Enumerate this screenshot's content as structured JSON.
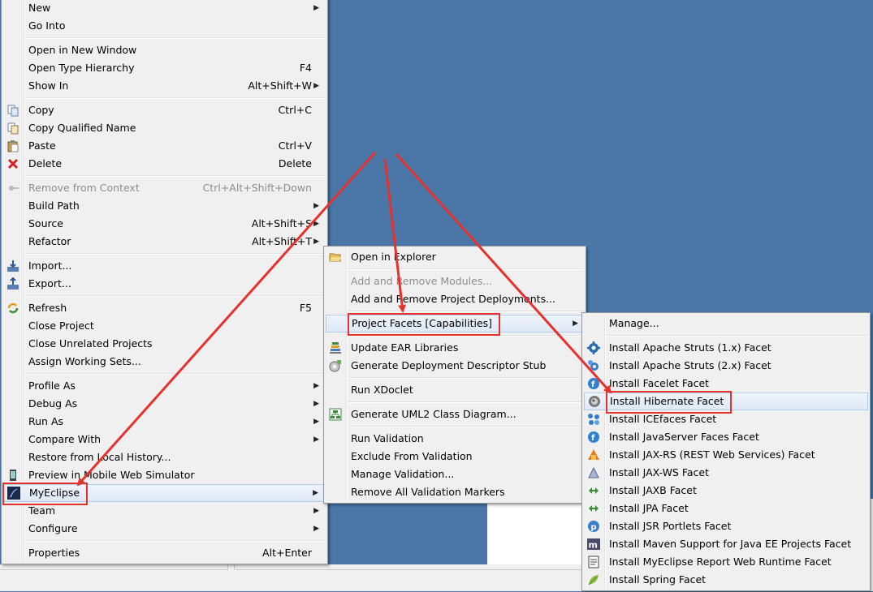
{
  "main_menu": {
    "items": [
      {
        "label": "New",
        "arrow": true
      },
      {
        "label": "Go Into"
      },
      {
        "sep": true
      },
      {
        "label": "Open in New Window"
      },
      {
        "label": "Open Type Hierarchy",
        "shortcut": "F4"
      },
      {
        "label": "Show In",
        "shortcut": "Alt+Shift+W",
        "arrow": true
      },
      {
        "sep": true
      },
      {
        "label": "Copy",
        "shortcut": "Ctrl+C",
        "icon": "copy-icon"
      },
      {
        "label": "Copy Qualified Name",
        "icon": "copy-qualified-icon"
      },
      {
        "label": "Paste",
        "shortcut": "Ctrl+V",
        "icon": "paste-icon"
      },
      {
        "label": "Delete",
        "shortcut": "Delete",
        "icon": "delete-icon"
      },
      {
        "sep": true
      },
      {
        "label": "Remove from Context",
        "shortcut": "Ctrl+Alt+Shift+Down",
        "icon": "remove-context-icon",
        "disabled": true
      },
      {
        "label": "Build Path",
        "arrow": true
      },
      {
        "label": "Source",
        "shortcut": "Alt+Shift+S",
        "arrow": true
      },
      {
        "label": "Refactor",
        "shortcut": "Alt+Shift+T",
        "arrow": true
      },
      {
        "sep": true
      },
      {
        "label": "Import...",
        "icon": "import-icon"
      },
      {
        "label": "Export...",
        "icon": "export-icon"
      },
      {
        "sep": true
      },
      {
        "label": "Refresh",
        "shortcut": "F5",
        "icon": "refresh-icon"
      },
      {
        "label": "Close Project"
      },
      {
        "label": "Close Unrelated Projects"
      },
      {
        "label": "Assign Working Sets..."
      },
      {
        "sep": true
      },
      {
        "label": "Profile As",
        "arrow": true
      },
      {
        "label": "Debug As",
        "arrow": true
      },
      {
        "label": "Run As",
        "arrow": true
      },
      {
        "label": "Compare With",
        "arrow": true
      },
      {
        "label": "Restore from Local History..."
      },
      {
        "label": "Preview in Mobile Web Simulator",
        "icon": "mobile-simulator-icon"
      },
      {
        "label": "MyEclipse",
        "arrow": true,
        "icon": "myeclipse-icon",
        "highlighted": true,
        "boxed": true
      },
      {
        "label": "Team",
        "arrow": true
      },
      {
        "label": "Configure",
        "arrow": true
      },
      {
        "sep": true
      },
      {
        "label": "Properties",
        "shortcut": "Alt+Enter"
      }
    ]
  },
  "myeclipse_menu": {
    "items": [
      {
        "label": "Open in Explorer",
        "icon": "folder-open-icon"
      },
      {
        "sep": true
      },
      {
        "label": "Add and Remove Modules...",
        "disabled": true
      },
      {
        "label": "Add and Remove Project Deployments..."
      },
      {
        "sep": true
      },
      {
        "label": "Project Facets [Capabilities]",
        "arrow": true,
        "highlighted": true,
        "boxed": true
      },
      {
        "sep": true
      },
      {
        "label": "Update EAR Libraries",
        "icon": "ear-libraries-icon"
      },
      {
        "label": "Generate Deployment Descriptor Stub",
        "icon": "descriptor-stub-icon"
      },
      {
        "sep": true
      },
      {
        "label": "Run XDoclet"
      },
      {
        "sep": true
      },
      {
        "label": "Generate UML2 Class Diagram...",
        "icon": "uml-diagram-icon"
      },
      {
        "sep": true
      },
      {
        "label": "Run Validation"
      },
      {
        "label": "Exclude From Validation"
      },
      {
        "label": "Manage Validation..."
      },
      {
        "label": "Remove All Validation Markers"
      }
    ]
  },
  "facets_menu": {
    "items": [
      {
        "label": "Manage..."
      },
      {
        "sep": true
      },
      {
        "label": "Install Apache Struts (1.x) Facet",
        "icon": "struts-gear-icon"
      },
      {
        "label": "Install Apache Struts (2.x) Facet",
        "icon": "struts2-gear-icon"
      },
      {
        "label": "Install Facelet Facet",
        "icon": "facelet-icon"
      },
      {
        "label": "Install Hibernate Facet",
        "icon": "hibernate-icon",
        "highlighted": true,
        "boxed": true
      },
      {
        "label": "Install ICEfaces Facet",
        "icon": "icefaces-icon"
      },
      {
        "label": "Install JavaServer Faces Facet",
        "icon": "jsf-icon"
      },
      {
        "label": "Install JAX-RS (REST Web Services) Facet",
        "icon": "jaxrs-icon"
      },
      {
        "label": "Install JAX-WS Facet",
        "icon": "jaxws-icon"
      },
      {
        "label": "Install JAXB Facet",
        "icon": "jaxb-icon"
      },
      {
        "label": "Install JPA Facet",
        "icon": "jpa-icon"
      },
      {
        "label": "Install JSR Portlets Facet",
        "icon": "portlet-icon"
      },
      {
        "label": "Install Maven Support for Java EE Projects Facet",
        "icon": "maven-icon"
      },
      {
        "label": "Install MyEclipse Report Web Runtime Facet",
        "icon": "report-icon"
      },
      {
        "label": "Install Spring Facet",
        "icon": "spring-leaf-icon"
      }
    ]
  },
  "colors": {
    "desktop": "#4a77a8",
    "menu_bg": "#f0f0f0",
    "annotation_red": "#e5322d",
    "highlight": "#dfe9f6"
  }
}
